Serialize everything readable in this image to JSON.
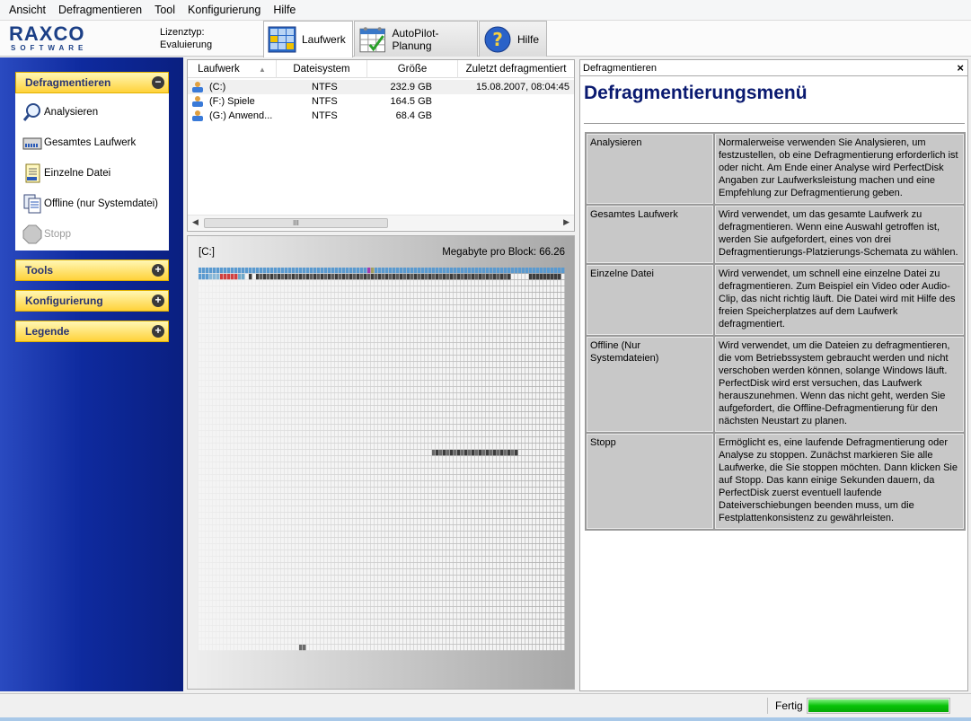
{
  "menubar": {
    "items": [
      "Ansicht",
      "Defragmentieren",
      "Tool",
      "Konfigurierung",
      "Hilfe"
    ]
  },
  "toolbar": {
    "logo_main": "RAXCO",
    "logo_sub": "SOFTWARE",
    "license_label": "Lizenztyp:",
    "license_value": "Evaluierung",
    "tabs": [
      {
        "label": "Laufwerk",
        "icon": "drive-grid-icon",
        "active": true
      },
      {
        "label": "AutoPilot-Planung",
        "icon": "calendar-icon",
        "active": false
      },
      {
        "label": "Hilfe",
        "icon": "help-icon",
        "active": false
      }
    ]
  },
  "sidebar": {
    "sections": [
      {
        "label": "Defragmentieren",
        "toggle": "−",
        "expanded": true
      },
      {
        "label": "Tools",
        "toggle": "+"
      },
      {
        "label": "Konfigurierung",
        "toggle": "+"
      },
      {
        "label": "Legende",
        "toggle": "+"
      }
    ],
    "items": [
      {
        "label": "Analysieren",
        "icon": "magnifier-icon",
        "enabled": true
      },
      {
        "label": "Gesamtes Laufwerk",
        "icon": "drive-icon",
        "enabled": true
      },
      {
        "label": "Einzelne Datei",
        "icon": "file-icon",
        "enabled": true
      },
      {
        "label": "Offline (nur Systemdatei)",
        "icon": "system-file-icon",
        "enabled": true
      },
      {
        "label": "Stopp",
        "icon": "stop-icon",
        "enabled": false
      }
    ]
  },
  "drivelist": {
    "columns": [
      "Laufwerk",
      "Dateisystem",
      "Größe",
      "Zuletzt defragmentiert"
    ],
    "rows": [
      {
        "drive": "(C:)",
        "fs": "NTFS",
        "size": "232.9 GB",
        "last": "15.08.2007, 08:04:45",
        "selected": true
      },
      {
        "drive": "(F:) Spiele",
        "fs": "NTFS",
        "size": "164.5 GB",
        "last": ""
      },
      {
        "drive": "(G:) Anwend...",
        "fs": "NTFS",
        "size": "68.4 GB",
        "last": ""
      }
    ],
    "scroll_grip": "III"
  },
  "diskmap": {
    "drive": "[C:]",
    "mb_label": "Megabyte pro Block: 66.26",
    "colors": {
      "free": "#f4f4f4",
      "contiguous": "#5a9ad0",
      "used": "#3c3c3c",
      "fragmented": "#d04040",
      "system": "#a03ab0"
    }
  },
  "infopanel": {
    "title": "Defragmentieren",
    "close": "×",
    "heading": "Defragmentierungsmenü",
    "rows": [
      {
        "key": "Analysieren",
        "text": "Normalerweise verwenden Sie Analysieren, um festzustellen, ob eine Defragmentierung erforderlich ist oder nicht. Am Ende einer Analyse wird PerfectDisk Angaben zur Laufwerksleistung machen und eine Empfehlung zur Defragmentierung geben."
      },
      {
        "key": "Gesamtes Laufwerk",
        "text": "Wird verwendet, um das gesamte Laufwerk zu defragmentieren. Wenn eine Auswahl getroffen ist, werden Sie aufgefordert, eines von drei Defragmentierungs-Platzierungs-Schemata zu wählen."
      },
      {
        "key": "Einzelne Datei",
        "text": "Wird verwendet, um schnell eine einzelne Datei zu defragmentieren. Zum Beispiel ein Video oder Audio-Clip, das nicht richtig läuft. Die Datei wird mit Hilfe des freien Speicherplatzes auf dem Laufwerk defragmentiert."
      },
      {
        "key": "Offline (Nur Systemdateien)",
        "text": "Wird verwendet, um die Dateien zu defragmentieren, die vom Betriebssystem gebraucht werden und nicht verschoben werden können, solange Windows läuft. PerfectDisk wird erst versuchen, das Laufwerk herauszunehmen. Wenn das nicht geht, werden Sie aufgefordert, die Offline-Defragmentierung für den nächsten Neustart zu planen."
      },
      {
        "key": "Stopp",
        "text": "Ermöglicht es, eine laufende Defragmentierung oder Analyse zu stoppen. Zunächst markieren Sie alle Laufwerke, die Sie stoppen möchten. Dann klicken Sie auf Stopp. Das kann einige Sekunden dauern, da PerfectDisk zuerst eventuell laufende Dateiverschiebungen beenden muss, um die Festplattenkonsistenz zu gewährleisten."
      }
    ]
  },
  "status": {
    "text": "Fertig",
    "progress": 1.0,
    "progress_color": "#08c208"
  }
}
